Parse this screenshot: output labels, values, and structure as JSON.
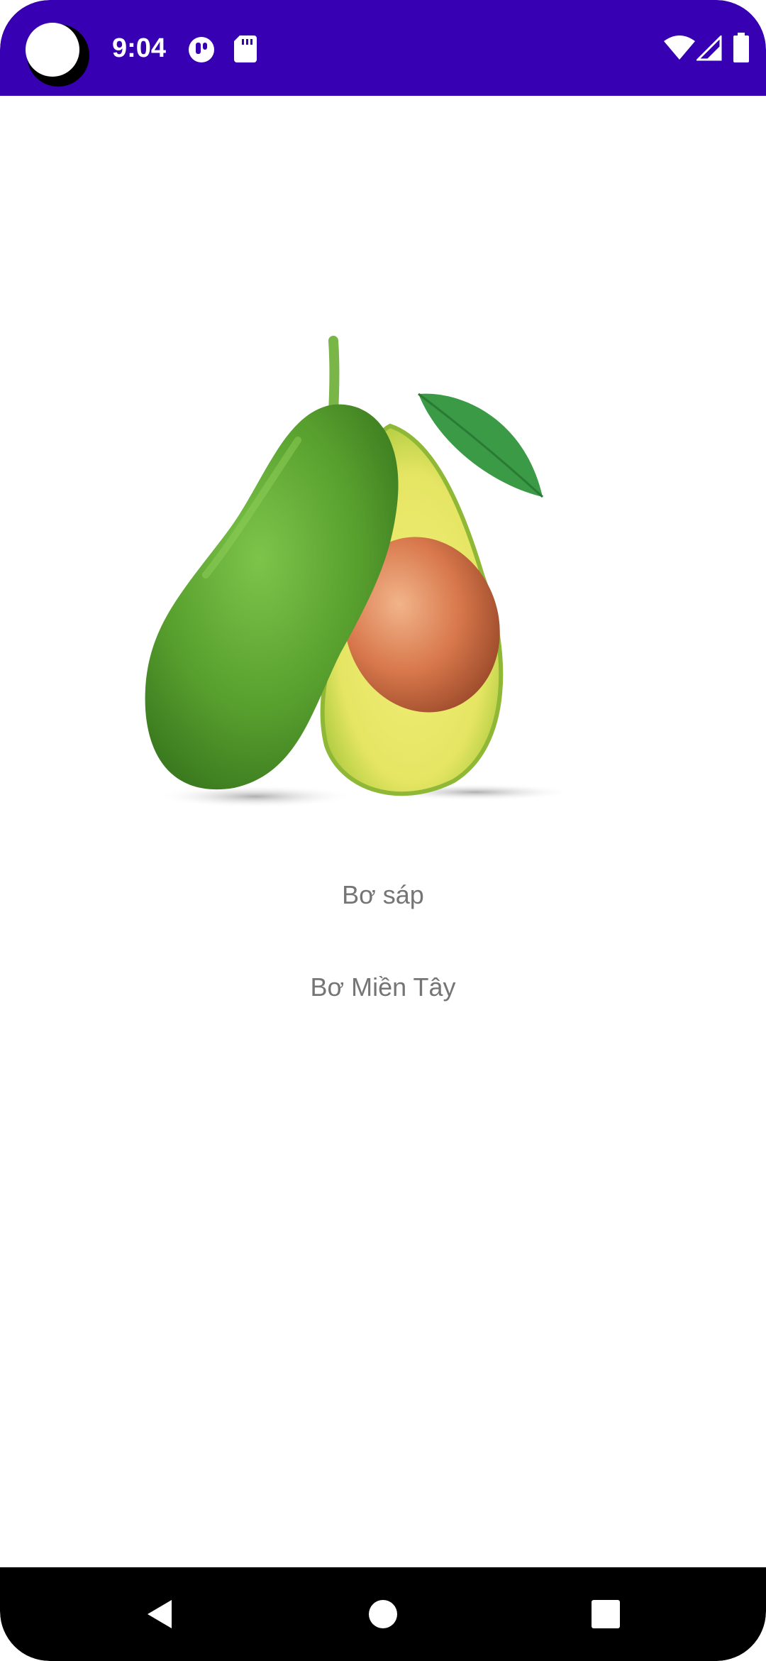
{
  "status_bar": {
    "time": "9:04",
    "background_color": "#3700b3",
    "left_icons": [
      "notification-app-icon",
      "sd-card-icon"
    ],
    "right_icons": [
      "wifi-icon",
      "cellular-signal-icon",
      "battery-icon"
    ]
  },
  "content": {
    "image": "avocado-image",
    "items": [
      {
        "label": "Bơ sáp"
      },
      {
        "label": "Bơ Miền Tây"
      }
    ],
    "text_color": "#757575"
  },
  "nav_bar": {
    "buttons": [
      "back-icon",
      "home-icon",
      "recents-icon"
    ]
  }
}
